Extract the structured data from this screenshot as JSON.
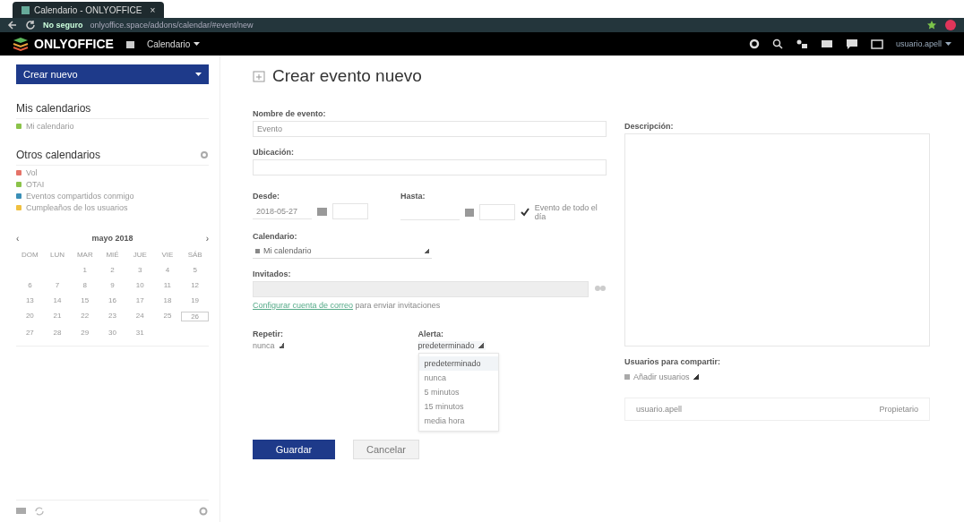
{
  "browser": {
    "tab_title": "Calendario - ONLYOFFICE",
    "tab_close": "×",
    "security": "No seguro",
    "url": "onlyoffice.space/addons/calendar/#event/new"
  },
  "header": {
    "logo": "ONLYOFFICE",
    "module": "Calendario",
    "user": "usuario.apell"
  },
  "sidebar": {
    "create_button": "Crear nuevo",
    "my_calendars": {
      "title": "Mis calendarios",
      "items": [
        {
          "label": "Mi calendario",
          "color": "#8bc34a"
        }
      ]
    },
    "other_calendars": {
      "title": "Otros calendarios",
      "items": [
        {
          "label": "Vol",
          "color": "#e57368"
        },
        {
          "label": "OTAI",
          "color": "#8bc34a"
        },
        {
          "label": "Eventos compartidos conmigo",
          "color": "#3a8fb7"
        },
        {
          "label": "Cumpleaños de los usuarios",
          "color": "#f0c040"
        }
      ]
    },
    "mini_calendar": {
      "prev": "‹",
      "next": "›",
      "month": "mayo 2018",
      "weekdays": [
        "DOM",
        "LUN",
        "MAR",
        "MIÉ",
        "JUE",
        "VIE",
        "SÁB"
      ],
      "weeks": [
        [
          {
            "day": "1",
            "today": false
          },
          {
            "day": "2",
            "today": false
          },
          {
            "day": "3",
            "today": false
          },
          {
            "day": "4",
            "today": false
          },
          {
            "day": "5",
            "today": false
          }
        ],
        [
          {
            "day": "6",
            "today": false
          },
          {
            "day": "7",
            "today": false
          },
          {
            "day": "8",
            "today": false
          },
          {
            "day": "9",
            "today": false
          },
          {
            "day": "10",
            "today": false
          },
          {
            "day": "11",
            "today": false
          },
          {
            "day": "12",
            "today": false
          }
        ],
        [
          {
            "day": "13",
            "today": false
          },
          {
            "day": "14",
            "today": false
          },
          {
            "day": "15",
            "today": false
          },
          {
            "day": "16",
            "today": false
          },
          {
            "day": "17",
            "today": false
          },
          {
            "day": "18",
            "today": false
          },
          {
            "day": "19",
            "today": false
          }
        ],
        [
          {
            "day": "20",
            "today": false
          },
          {
            "day": "21",
            "today": false
          },
          {
            "day": "22",
            "today": false
          },
          {
            "day": "23",
            "today": false
          },
          {
            "day": "24",
            "today": false
          },
          {
            "day": "25",
            "today": false
          },
          {
            "day": "26",
            "today": true
          }
        ],
        [
          {
            "day": "27",
            "today": false
          },
          {
            "day": "28",
            "today": false
          },
          {
            "day": "29",
            "today": false
          },
          {
            "day": "30",
            "today": false
          },
          {
            "day": "31",
            "today": false
          }
        ]
      ]
    }
  },
  "form": {
    "title": "Crear evento nuevo",
    "name": {
      "label": "Nombre de evento:",
      "value": "Evento"
    },
    "location": {
      "label": "Ubicación:"
    },
    "from": {
      "label": "Desde:",
      "date": "2018-05-27"
    },
    "to": {
      "label": "Hasta:"
    },
    "all_day": {
      "label": "Evento de todo el día",
      "checked": true
    },
    "calendar": {
      "label": "Calendario:",
      "value": "Mi calendario"
    },
    "guests": {
      "label": "Invitados:",
      "link": "Configurar cuenta de correo",
      "note": "para enviar invitaciones"
    },
    "repeat": {
      "label": "Repetir:",
      "value": "nunca"
    },
    "alert": {
      "label": "Alerta:",
      "value": "predeterminado",
      "expanded": true,
      "options": [
        {
          "label": "predeterminado",
          "selected": true
        },
        {
          "label": "nunca",
          "selected": false
        },
        {
          "label": "5 minutos",
          "selected": false
        },
        {
          "label": "15 minutos",
          "selected": false
        },
        {
          "label": "media hora",
          "selected": false
        }
      ]
    },
    "save": "Guardar",
    "cancel": "Cancelar",
    "description": {
      "label": "Descripción:"
    },
    "sharing": {
      "label": "Usuarios para compartir:",
      "add": "Añadir usuarios",
      "rows": [
        {
          "user": "usuario.apell",
          "role": "Propietario"
        }
      ]
    }
  }
}
